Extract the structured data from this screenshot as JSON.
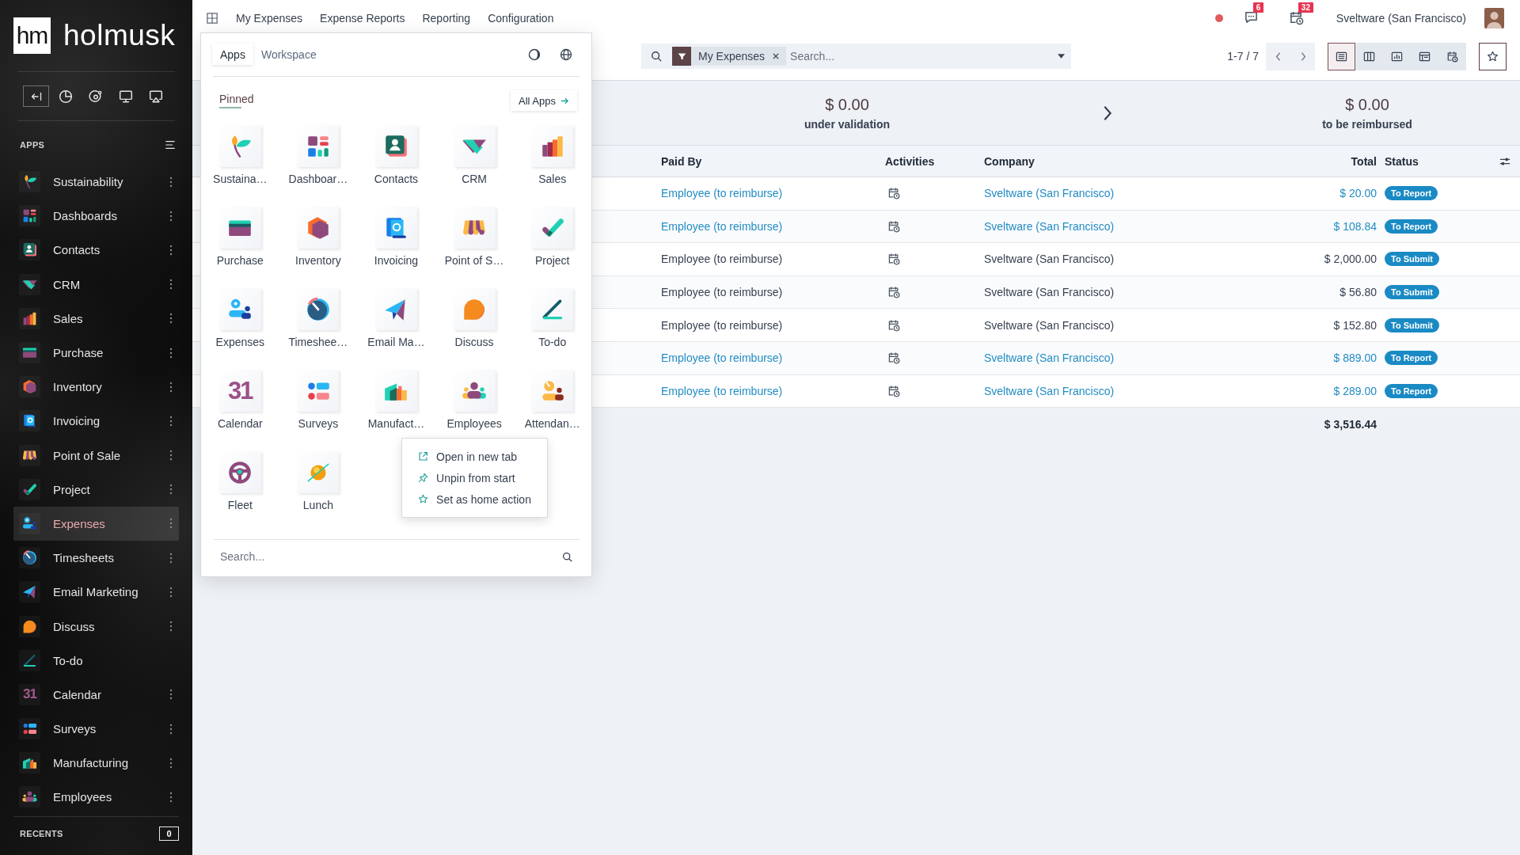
{
  "sidebar": {
    "logo": {
      "mark": "hm",
      "name": "holmusk"
    },
    "apps_heading": "APPS",
    "apps": [
      {
        "label": "Sustainability",
        "selected": false,
        "menu_button": true
      },
      {
        "label": "Dashboards",
        "selected": false,
        "menu_button": true
      },
      {
        "label": "Contacts",
        "selected": false,
        "menu_button": true
      },
      {
        "label": "CRM",
        "selected": false,
        "menu_button": true
      },
      {
        "label": "Sales",
        "selected": false,
        "menu_button": true
      },
      {
        "label": "Purchase",
        "selected": false,
        "menu_button": true
      },
      {
        "label": "Inventory",
        "selected": false,
        "menu_button": true
      },
      {
        "label": "Invoicing",
        "selected": false,
        "menu_button": true
      },
      {
        "label": "Point of Sale",
        "selected": false,
        "menu_button": true
      },
      {
        "label": "Project",
        "selected": false,
        "menu_button": true
      },
      {
        "label": "Expenses",
        "selected": true,
        "menu_button": true
      },
      {
        "label": "Timesheets",
        "selected": false,
        "menu_button": true
      },
      {
        "label": "Email Marketing",
        "selected": false,
        "menu_button": true
      },
      {
        "label": "Discuss",
        "selected": false,
        "menu_button": true
      },
      {
        "label": "To-do",
        "selected": false,
        "menu_button": false
      },
      {
        "label": "Calendar",
        "selected": false,
        "menu_button": true,
        "glyph": "31"
      },
      {
        "label": "Surveys",
        "selected": false,
        "menu_button": true
      },
      {
        "label": "Manufacturing",
        "selected": false,
        "menu_button": true
      },
      {
        "label": "Employees",
        "selected": false,
        "menu_button": true
      }
    ],
    "recents": {
      "label": "RECENTS",
      "count": "0"
    }
  },
  "topbar": {
    "menu": [
      "My Expenses",
      "Expense Reports",
      "Reporting",
      "Configuration"
    ],
    "messages_count": "6",
    "activities_count": "32",
    "company": "Sveltware (San Francisco)"
  },
  "control_panel": {
    "facet": "My Expenses",
    "search": {
      "placeholder": "Search..."
    },
    "pager": "1-7 / 7",
    "views": [
      {
        "selected": true
      },
      {
        "selected": false
      },
      {
        "selected": false
      },
      {
        "selected": false
      },
      {
        "selected": false
      }
    ]
  },
  "summary": [
    {
      "amount": "$ 0.00",
      "label": "under validation"
    },
    {
      "amount": "$ 0.00",
      "label": "to be reimbursed"
    }
  ],
  "table": {
    "columns": [
      "Paid By",
      "Activities",
      "Company",
      "Total",
      "Status"
    ],
    "rows": [
      {
        "paid_by": "Employee (to reimburse)",
        "company": "Sveltware (San Francisco)",
        "total": "$ 20.00",
        "status": "To Report",
        "highlighted": true
      },
      {
        "paid_by": "Employee (to reimburse)",
        "company": "Sveltware (San Francisco)",
        "total": "$ 108.84",
        "status": "To Report",
        "highlighted": true
      },
      {
        "paid_by": "Employee (to reimburse)",
        "company": "Sveltware (San Francisco)",
        "total": "$ 2,000.00",
        "status": "To Submit",
        "highlighted": false
      },
      {
        "paid_by": "Employee (to reimburse)",
        "company": "Sveltware (San Francisco)",
        "total": "$ 56.80",
        "status": "To Submit",
        "highlighted": false
      },
      {
        "paid_by": "Employee (to reimburse)",
        "company": "Sveltware (San Francisco)",
        "total": "$ 152.80",
        "status": "To Submit",
        "highlighted": false
      },
      {
        "paid_by": "Employee (to reimburse)",
        "company": "Sveltware (San Francisco)",
        "total": "$ 889.00",
        "status": "To Report",
        "highlighted": true
      },
      {
        "paid_by": "Employee (to reimburse)",
        "company": "Sveltware (San Francisco)",
        "total": "$ 289.00",
        "status": "To Report",
        "highlighted": true
      }
    ],
    "total": "$ 3,516.44"
  },
  "app_menu": {
    "tabs": [
      {
        "label": "Apps",
        "selected": true
      },
      {
        "label": "Workspace",
        "selected": false
      }
    ],
    "section": "Pinned",
    "all_apps": "All Apps",
    "apps": [
      {
        "label": "Sustaina…",
        "menu_open": false
      },
      {
        "label": "Dashboar…",
        "menu_open": false
      },
      {
        "label": "Contacts",
        "menu_open": false
      },
      {
        "label": "CRM",
        "menu_open": false
      },
      {
        "label": "Sales",
        "menu_open": false
      },
      {
        "label": "Purchase",
        "menu_open": false
      },
      {
        "label": "Inventory",
        "menu_open": false
      },
      {
        "label": "Invoicing",
        "menu_open": false
      },
      {
        "label": "Point of S…",
        "menu_open": false
      },
      {
        "label": "Project",
        "menu_open": false
      },
      {
        "label": "Expenses",
        "menu_open": false
      },
      {
        "label": "Timeshee…",
        "menu_open": false
      },
      {
        "label": "Email Ma…",
        "menu_open": false
      },
      {
        "label": "Discuss",
        "menu_open": false
      },
      {
        "label": "To-do",
        "menu_open": false
      },
      {
        "label": "Calendar",
        "menu_open": false,
        "glyph": "31"
      },
      {
        "label": "Surveys",
        "menu_open": false
      },
      {
        "label": "Manufact…",
        "menu_open": false
      },
      {
        "label": "Employees",
        "menu_open": true
      },
      {
        "label": "Attendan…",
        "menu_open": false
      },
      {
        "label": "Fleet",
        "menu_open": false
      },
      {
        "label": "Lunch",
        "menu_open": false
      }
    ],
    "context_menu": [
      "Open in new tab",
      "Unpin from start",
      "Set as home action"
    ],
    "search": {
      "placeholder": "Search..."
    }
  }
}
